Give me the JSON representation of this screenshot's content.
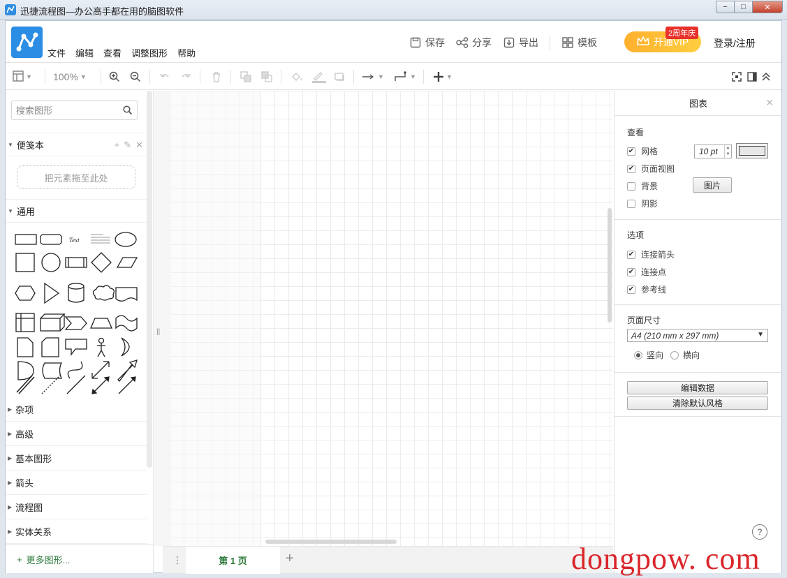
{
  "window": {
    "title": "迅捷流程图—办公高手都在用的脑图软件",
    "min": "−",
    "max": "□",
    "close": "✕"
  },
  "menu": [
    "文件",
    "编辑",
    "查看",
    "调整图形",
    "帮助"
  ],
  "header_actions": {
    "save": "保存",
    "share": "分享",
    "export": "导出",
    "template": "模板"
  },
  "vip": {
    "label": "开通VIP",
    "badge": "2周年庆"
  },
  "login": "登录/注册",
  "toolbar": {
    "zoom": "100%"
  },
  "sidebar": {
    "search_placeholder": "搜索图形",
    "scratchpad": {
      "title": "便笺本",
      "drop_hint": "把元素拖至此处"
    },
    "general": {
      "title": "通用",
      "text_shape": "Text"
    },
    "sections": [
      "杂项",
      "高级",
      "基本图形",
      "箭头",
      "流程图",
      "实体关系"
    ],
    "more": "更多图形..."
  },
  "pagebar": {
    "tab": "第 1 页",
    "add": "+",
    "dots": "⋮"
  },
  "panel": {
    "title": "图表",
    "view": {
      "title": "查看",
      "grid": "网格",
      "grid_size": "10 pt",
      "page_view": "页面视图",
      "background": "背景",
      "image_button": "图片",
      "shadow": "阴影"
    },
    "options": {
      "title": "选项",
      "connection_arrows": "连接箭头",
      "connection_points": "连接点",
      "guides": "参考线"
    },
    "page_size": {
      "title": "页面尺寸",
      "selected": "A4 (210 mm x 297 mm)",
      "portrait": "竖向",
      "landscape": "横向"
    },
    "edit_data": "编辑数据",
    "clear_default_style": "清除默认风格"
  },
  "help": "?",
  "watermark": "dongpow. com",
  "colors": {
    "accent": "#2b8de4",
    "vip": "#ffb02e",
    "watermark": "#d9262a",
    "page_tab": "#2b7a3a"
  }
}
